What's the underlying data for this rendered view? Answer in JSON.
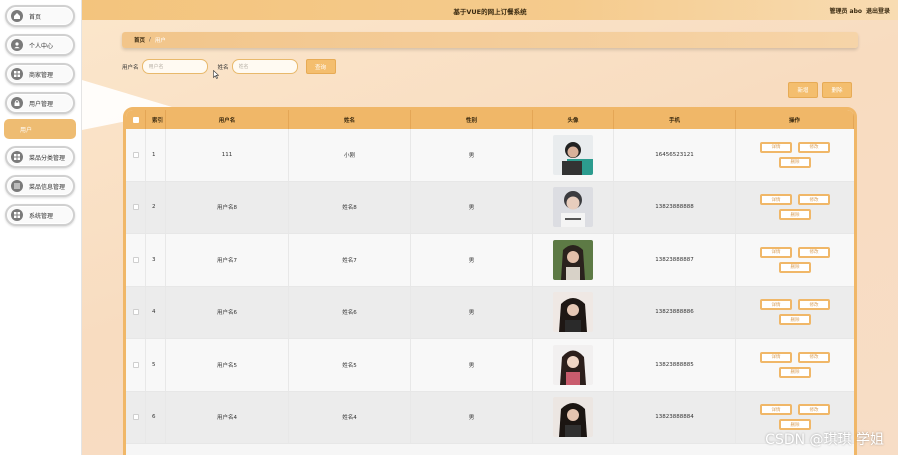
{
  "header": {
    "title": "基于VUE的网上订餐系统",
    "user": "管理员 abo",
    "logout": "退出登录"
  },
  "sidebar": {
    "items": [
      {
        "label": "首页",
        "icon": "home-icon"
      },
      {
        "label": "个人中心",
        "icon": "user-icon"
      },
      {
        "label": "商家管理",
        "icon": "grid-icon"
      },
      {
        "label": "用户管理",
        "icon": "lock-icon"
      },
      {
        "label": "菜品分类管理",
        "icon": "grid-icon"
      },
      {
        "label": "菜品信息管理",
        "icon": "list-icon"
      },
      {
        "label": "系统管理",
        "icon": "grid-icon"
      }
    ],
    "active_sub": "用户"
  },
  "breadcrumb": {
    "home": "首页",
    "sep": "/",
    "current": "用户"
  },
  "search": {
    "username_label": "用户名",
    "username_placeholder": "用户名",
    "name_label": "姓名",
    "name_placeholder": "姓名",
    "query_label": "查询"
  },
  "actions": {
    "add": "新增",
    "delete": "删除"
  },
  "table": {
    "headers": {
      "index": "索引",
      "username": "用户名",
      "name": "姓名",
      "sex": "性别",
      "avatar": "头像",
      "phone": "手机",
      "op": "操作"
    },
    "op_labels": {
      "detail": "详情",
      "edit": "修改",
      "delete": "删除"
    },
    "rows": [
      {
        "index": "1",
        "username": "111",
        "name": "小刚",
        "sex": "男",
        "phone": "16456523121"
      },
      {
        "index": "2",
        "username": "用户名8",
        "name": "姓名8",
        "sex": "男",
        "phone": "13823888888"
      },
      {
        "index": "3",
        "username": "用户名7",
        "name": "姓名7",
        "sex": "男",
        "phone": "13823888887"
      },
      {
        "index": "4",
        "username": "用户名6",
        "name": "姓名6",
        "sex": "男",
        "phone": "13823888886"
      },
      {
        "index": "5",
        "username": "用户名5",
        "name": "姓名5",
        "sex": "男",
        "phone": "13823888885"
      },
      {
        "index": "6",
        "username": "用户名4",
        "name": "姓名4",
        "sex": "男",
        "phone": "13823888884"
      }
    ]
  },
  "watermark": "CSDN @琪琪 学姐",
  "colors": {
    "accent": "#f0b768",
    "header": "#f3c47d",
    "sidebar_active": "#eebc72"
  }
}
